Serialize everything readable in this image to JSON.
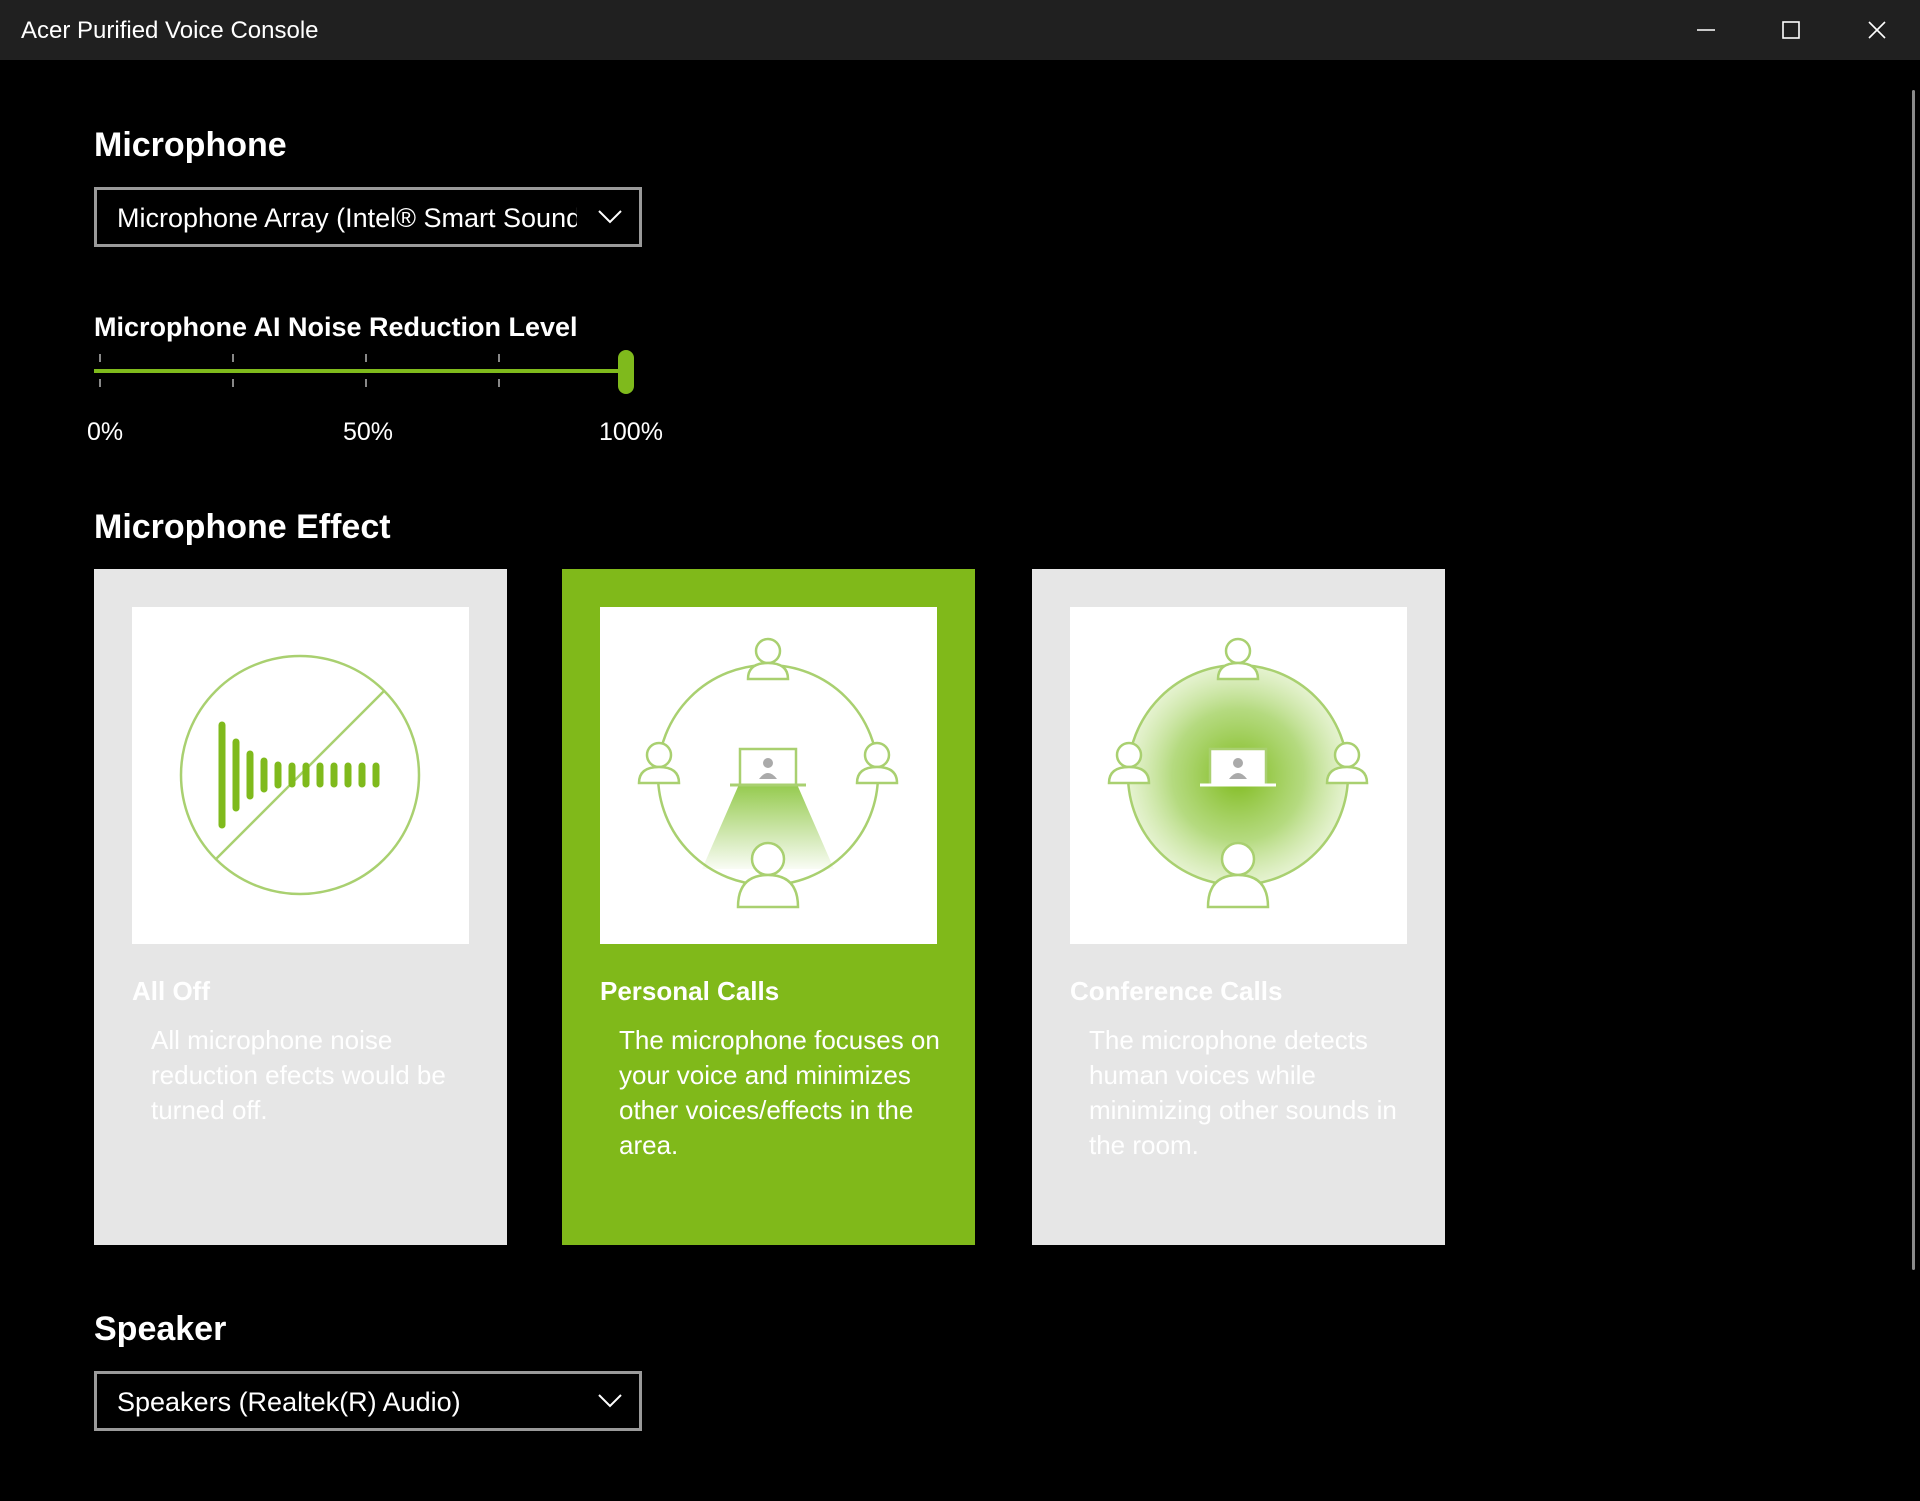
{
  "window": {
    "title": "Acer Purified Voice Console",
    "controls": {
      "minimize": "minimize-icon",
      "maximize": "maximize-icon",
      "close": "close-icon"
    }
  },
  "microphone": {
    "section_title": "Microphone",
    "device": "Microphone Array (Intel® Smart Sound Technology for Digital Microphones)",
    "noise_reduction": {
      "title": "Microphone AI Noise Reduction Level",
      "value_percent": 100,
      "labels": [
        "0%",
        "50%",
        "100%"
      ]
    }
  },
  "microphone_effect": {
    "section_title": "Microphone Effect",
    "selected": "Personal Calls",
    "options": [
      {
        "title": "All Off",
        "description": "All microphone noise reduction efects would be turned off.",
        "icon": "sound-off-icon"
      },
      {
        "title": "Personal Calls",
        "description": "The microphone focuses on your voice and minimizes other voices/effects in the area.",
        "icon": "personal-calls-icon"
      },
      {
        "title": "Conference Calls",
        "description": "The microphone detects human voices while minimizing other sounds in the room.",
        "icon": "conference-calls-icon"
      }
    ]
  },
  "speaker": {
    "section_title": "Speaker",
    "device": "Speakers (Realtek(R) Audio)"
  },
  "colors": {
    "accent": "#80b91a",
    "background": "#000000",
    "titlebar": "#202020",
    "card_inactive": "#e6e6e6",
    "icon_line": "#a9d070"
  }
}
